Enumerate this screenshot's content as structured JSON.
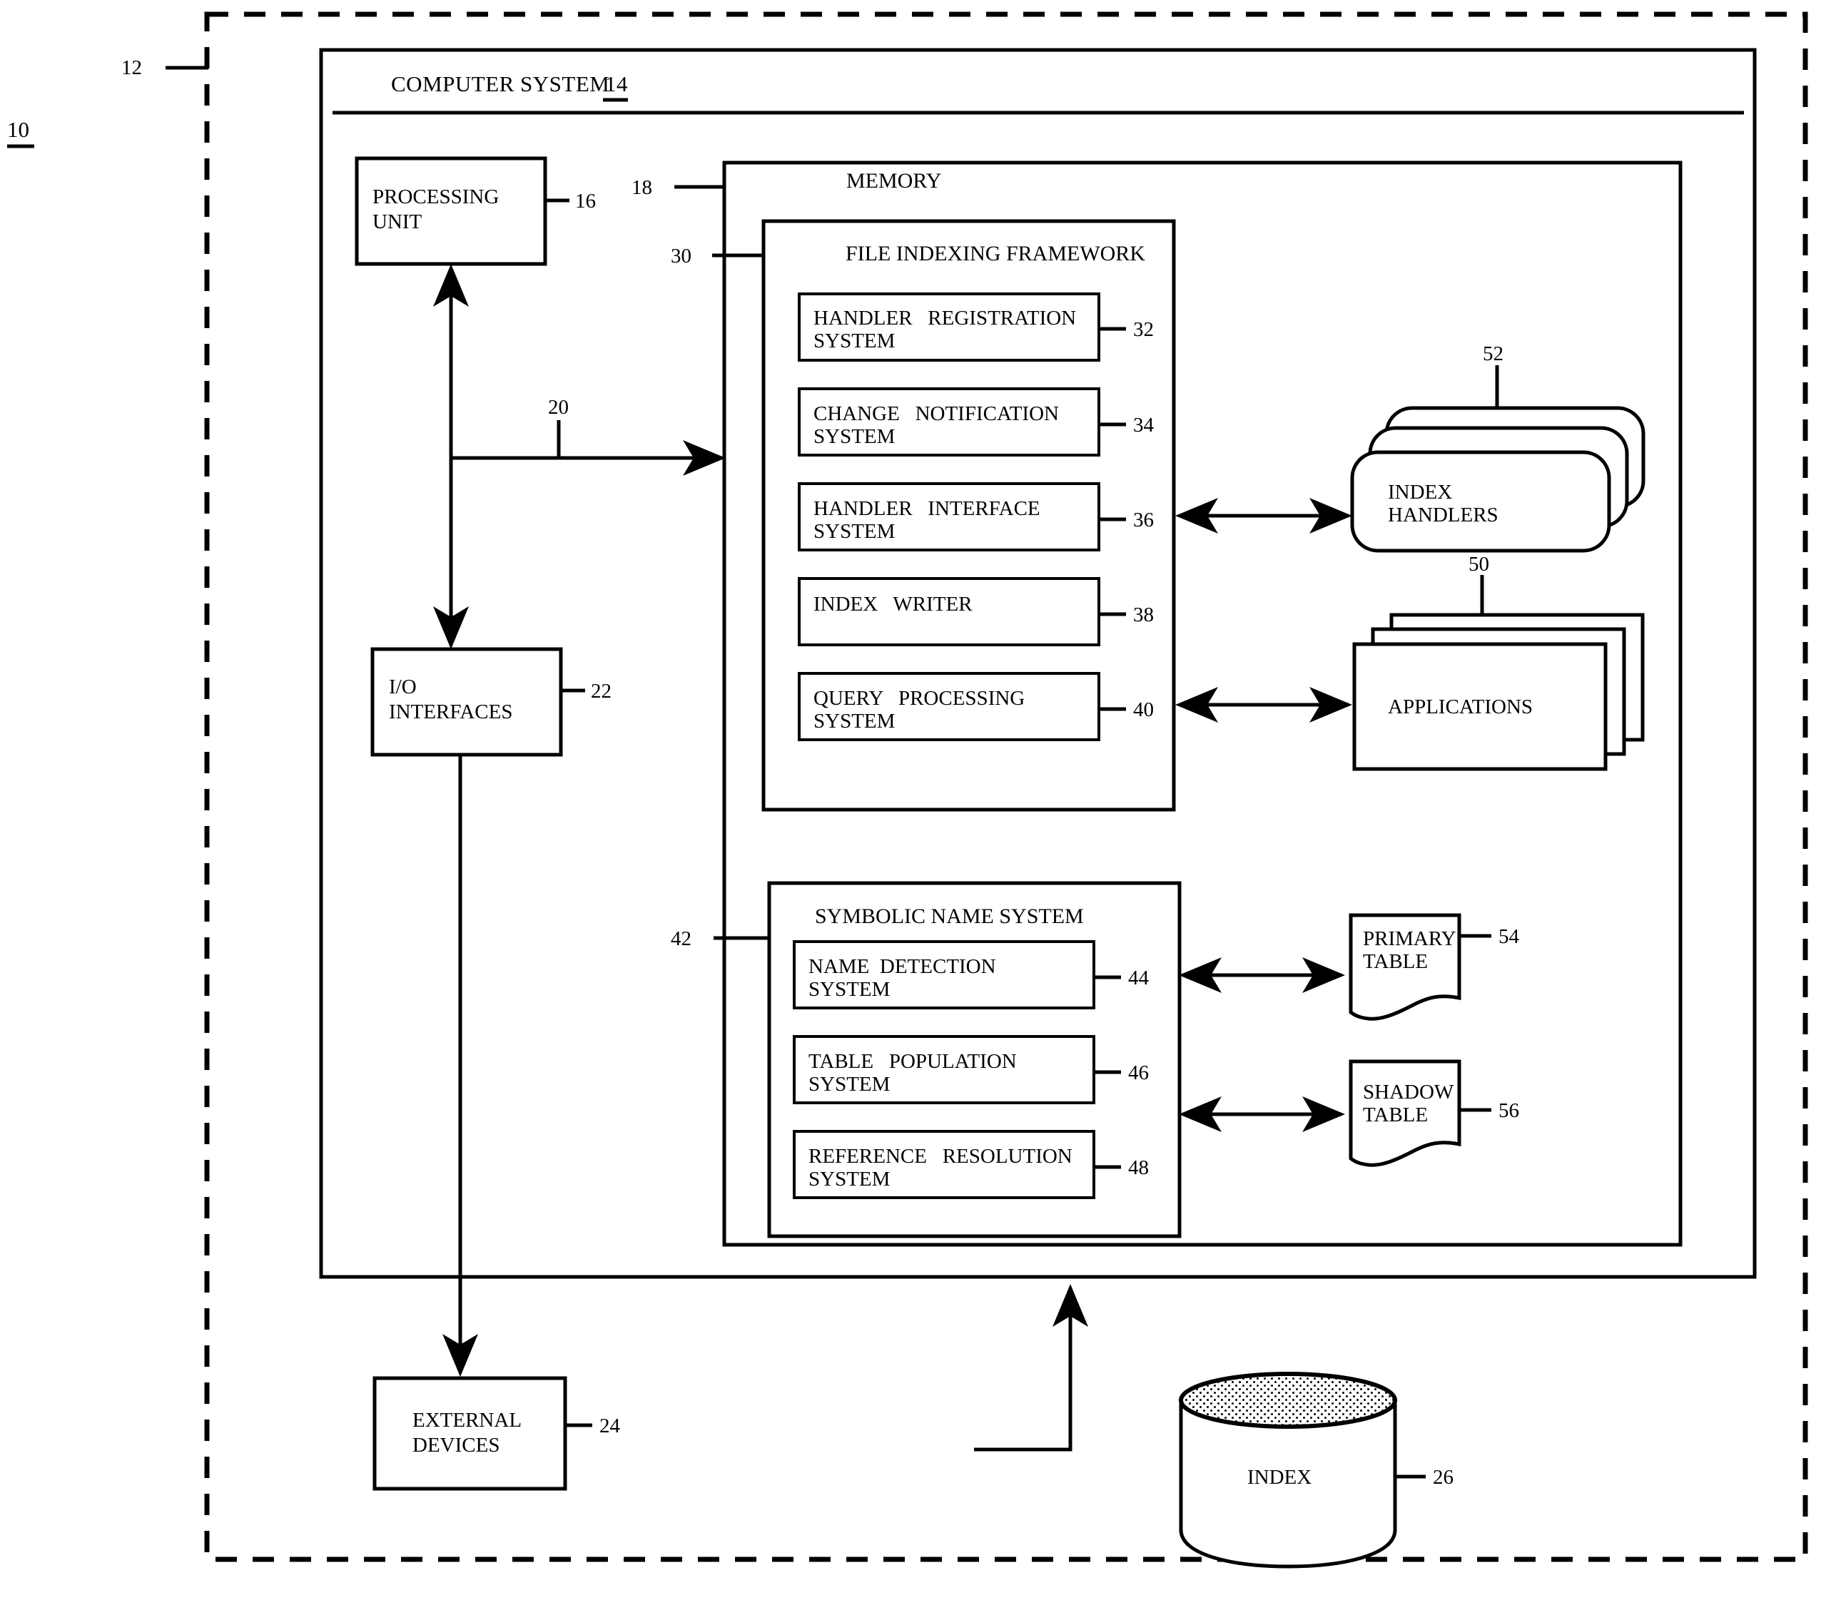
{
  "figure": {
    "system_ref": "10",
    "boundary_ref": "12"
  },
  "computer_system": {
    "title": "COMPUTER SYSTEM",
    "ref": "14"
  },
  "processing_unit": {
    "label_line1": "PROCESSING",
    "label_line2": "UNIT",
    "ref": "16"
  },
  "bus": {
    "ref": "20"
  },
  "io_interfaces": {
    "label_line1": "I/O",
    "label_line2": "INTERFACES",
    "ref": "22"
  },
  "external_devices": {
    "label_line1": "EXTERNAL",
    "label_line2": "DEVICES",
    "ref": "24"
  },
  "index_store": {
    "label": "INDEX",
    "ref": "26"
  },
  "memory": {
    "title": "MEMORY",
    "ref": "18"
  },
  "file_indexing_framework": {
    "title": "FILE INDEXING FRAMEWORK",
    "ref": "30",
    "components": [
      {
        "line1": "HANDLER   REGISTRATION",
        "line2": "SYSTEM",
        "ref": "32"
      },
      {
        "line1": "CHANGE   NOTIFICATION",
        "line2": "SYSTEM",
        "ref": "34"
      },
      {
        "line1": "HANDLER   INTERFACE",
        "line2": "SYSTEM",
        "ref": "36"
      },
      {
        "line1": "INDEX   WRITER",
        "line2": "",
        "ref": "38"
      },
      {
        "line1": "QUERY   PROCESSING",
        "line2": "SYSTEM",
        "ref": "40"
      }
    ]
  },
  "symbolic_name_system": {
    "title": "SYMBOLIC NAME SYSTEM",
    "ref": "42",
    "components": [
      {
        "line1": "NAME  DETECTION",
        "line2": "SYSTEM",
        "ref": "44"
      },
      {
        "line1": "TABLE   POPULATION",
        "line2": "SYSTEM",
        "ref": "46"
      },
      {
        "line1": "REFERENCE   RESOLUTION",
        "line2": "SYSTEM",
        "ref": "48"
      }
    ]
  },
  "index_handlers": {
    "label_line1": "INDEX",
    "label_line2": "HANDLERS",
    "ref": "52"
  },
  "applications": {
    "label": "APPLICATIONS",
    "ref": "50"
  },
  "primary_table": {
    "label_line1": "PRIMARY",
    "label_line2": "TABLE",
    "ref": "54"
  },
  "shadow_table": {
    "label_line1": "SHADOW",
    "label_line2": "TABLE",
    "ref": "56"
  }
}
